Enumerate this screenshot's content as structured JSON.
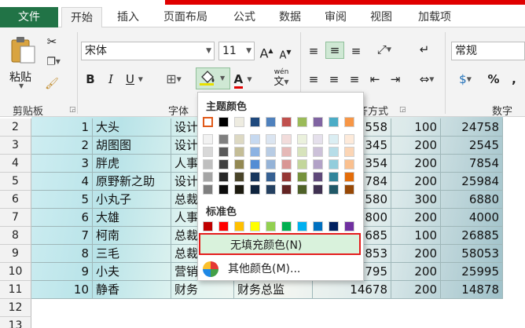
{
  "tabs": {
    "file": "文件",
    "items": [
      "开始",
      "插入",
      "页面布局",
      "公式",
      "数据",
      "审阅",
      "视图",
      "加载项"
    ]
  },
  "ribbon": {
    "clipboard": {
      "paste": "粘贴",
      "label": "剪贴板"
    },
    "font": {
      "name": "宋体",
      "size": "11",
      "label": "字体",
      "bold": "B",
      "italic": "I",
      "underline": "U",
      "grow": "A",
      "shrink": "A",
      "fontcolor_letter": "A",
      "phonetic": "wén",
      "phonetic_char": "文"
    },
    "alignment": {
      "label": "对齐方式",
      "partial": "齐方式"
    },
    "number": {
      "format": "常规",
      "label": "数字",
      "percent": "%",
      "comma": ","
    }
  },
  "dropdown": {
    "theme_title": "主题颜色",
    "standard_title": "标准色",
    "no_fill": "无填充颜色(N)",
    "more_colors": "其他颜色(M)...",
    "theme_top": [
      "#ffffff",
      "#000000",
      "#eeece1",
      "#1f497d",
      "#4f81bd",
      "#c0504d",
      "#9bbb59",
      "#8064a2",
      "#4bacc6",
      "#f79646"
    ],
    "theme_shades": [
      [
        "#f2f2f2",
        "#7f7f7f",
        "#ddd9c3",
        "#c6d9f0",
        "#dbe5f1",
        "#f2dcdb",
        "#ebf1dd",
        "#e5e0ec",
        "#dbeef3",
        "#fdeada"
      ],
      [
        "#d8d8d8",
        "#595959",
        "#c4bd97",
        "#8db3e2",
        "#b8cce4",
        "#e5b9b7",
        "#d7e3bc",
        "#ccc1d9",
        "#b7dde8",
        "#fbd5b5"
      ],
      [
        "#bfbfbf",
        "#3f3f3f",
        "#938953",
        "#548dd4",
        "#95b3d7",
        "#d99694",
        "#c3d69b",
        "#b2a2c7",
        "#92cddc",
        "#fac08f"
      ],
      [
        "#a5a5a5",
        "#262626",
        "#494429",
        "#17365d",
        "#366092",
        "#953734",
        "#76923c",
        "#5f497a",
        "#31859b",
        "#e36c09"
      ],
      [
        "#7f7f7f",
        "#0c0c0c",
        "#1d1b10",
        "#0f243e",
        "#244061",
        "#632423",
        "#4f6128",
        "#3f3151",
        "#205867",
        "#974806"
      ]
    ],
    "standard": [
      "#c00000",
      "#ff0000",
      "#ffc000",
      "#ffff00",
      "#92d050",
      "#00b050",
      "#00b0f0",
      "#0070c0",
      "#002060",
      "#7030a0"
    ]
  },
  "sheet": {
    "rows": [
      {
        "row": "2",
        "id": "1",
        "name": "大头",
        "dept": "设计",
        "title": "",
        "salary": "",
        "partial": "558",
        "hours": "100",
        "total": "24758"
      },
      {
        "row": "3",
        "id": "2",
        "name": "胡图图",
        "dept": "设计",
        "title": "",
        "salary": "",
        "partial": "345",
        "hours": "200",
        "total": "2545"
      },
      {
        "row": "4",
        "id": "3",
        "name": "胖虎",
        "dept": "人事",
        "title": "",
        "salary": "",
        "partial": "354",
        "hours": "200",
        "total": "7854"
      },
      {
        "row": "5",
        "id": "4",
        "name": "原野新之助",
        "dept": "设计",
        "title": "",
        "salary": "",
        "partial": "784",
        "hours": "200",
        "total": "25984"
      },
      {
        "row": "6",
        "id": "5",
        "name": "小丸子",
        "dept": "总裁",
        "title": "",
        "salary": "",
        "partial": "580",
        "hours": "300",
        "total": "6880"
      },
      {
        "row": "7",
        "id": "6",
        "name": "大雄",
        "dept": "人事",
        "title": "",
        "salary": "",
        "partial": "800",
        "hours": "200",
        "total": "4000"
      },
      {
        "row": "8",
        "id": "7",
        "name": "柯南",
        "dept": "总裁",
        "title": "",
        "salary": "",
        "partial": "685",
        "hours": "100",
        "total": "26885"
      },
      {
        "row": "9",
        "id": "8",
        "name": "三毛",
        "dept": "总裁",
        "title": "",
        "salary": "",
        "partial": "853",
        "hours": "200",
        "total": "58053"
      },
      {
        "row": "10",
        "id": "9",
        "name": "小夫",
        "dept": "营销",
        "title": "",
        "salary": "",
        "partial": "795",
        "hours": "200",
        "total": "25995"
      },
      {
        "row": "11",
        "id": "10",
        "name": "静香",
        "dept": "财务",
        "title": "财务总监",
        "salary": "14678",
        "partial": "",
        "hours": "200",
        "total": "14878"
      }
    ],
    "extra_rows": [
      "12",
      "13"
    ]
  },
  "colors": {
    "accent": "#217346",
    "highlight_border": "#e41c1c",
    "highlight_fill": "#d9f2dc"
  }
}
